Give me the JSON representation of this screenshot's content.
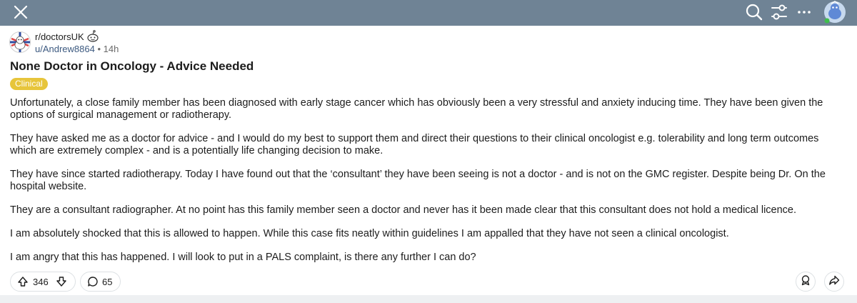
{
  "topbar": {
    "close_icon": "close-icon",
    "search_icon": "search-icon",
    "filter_icon": "filters-icon",
    "more_icon": "more-icon",
    "avatar_icon": "user-avatar"
  },
  "post": {
    "subreddit": "r/doctorsUK",
    "author": "u/Andrew8864",
    "separator": "•",
    "age": "14h",
    "title": "None Doctor in Oncology - Advice Needed",
    "flair": "Clinical",
    "flair_color": "#e7c53b",
    "paragraphs": [
      "Unfortunately, a close family member has been diagnosed with early stage cancer which has obviously been a very stressful and anxiety inducing time. They have been given the options of surgical management or radiotherapy.",
      "They have asked me as a doctor for advice - and I would do my best to support them and direct their questions to their clinical oncologist e.g. tolerability and long term outcomes which are extremely complex - and is a potentially life changing decision to make.",
      "They have since started radiotherapy. Today I have found out that the ‘consultant’ they have been seeing is not a doctor - and is not on the GMC register. Despite being Dr. On the hospital website.",
      "They are a consultant radiographer. At no point has this family member seen a doctor and never has it been made clear that this consultant does not hold a medical licence.",
      "I am absolutely shocked that this is allowed to happen. While this case fits neatly within guidelines I am appalled that they have not seen a clinical oncologist.",
      "I am angry that this has happened. I will look to put in a PALS complaint, is there any further I can do?"
    ]
  },
  "actions": {
    "upvotes": "346",
    "comments": "65",
    "upvote_icon": "upvote-icon",
    "downvote_icon": "downvote-icon",
    "comment_icon": "comment-icon",
    "award_icon": "award-icon",
    "share_icon": "share-icon"
  },
  "colors": {
    "topbar": "#6f8395",
    "link": "#3d5a80"
  }
}
